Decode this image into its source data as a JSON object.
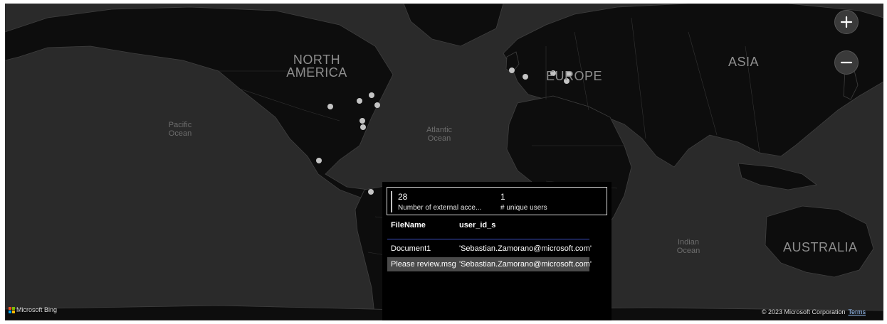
{
  "map": {
    "continents": [
      "NORTH AMERICA",
      "EUROPE",
      "ASIA",
      "AUSTRALIA"
    ],
    "oceans": [
      "Pacific Ocean",
      "Atlantic Ocean",
      "Indian Ocean"
    ],
    "zoom_in_icon": "plus-icon",
    "zoom_out_icon": "minus-icon",
    "attribution_brand": "Microsoft Bing",
    "copyright": "© 2023 Microsoft Corporation",
    "terms_link": "Terms",
    "colors": {
      "water": "#2a2a2a",
      "land": "#0d0d0d",
      "borders": "#3f3f3f",
      "marker": "#c4c4c4"
    }
  },
  "popup": {
    "kpis": [
      {
        "value": "28",
        "label": "Number of external acce..."
      },
      {
        "value": "1",
        "label": "# unique users"
      }
    ],
    "table": {
      "columns": [
        "FileName",
        "user_id_s"
      ],
      "rows": [
        {
          "file": "Document1",
          "user": "'Sebastian.Zamorano@microsoft.com'"
        },
        {
          "file": "Please review.msg",
          "user": "'Sebastian.Zamorano@microsoft.com'"
        }
      ],
      "selected_row": 1
    }
  }
}
